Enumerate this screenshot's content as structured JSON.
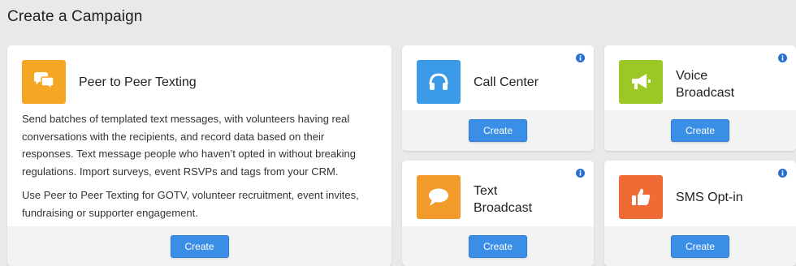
{
  "page": {
    "title": "Create a Campaign"
  },
  "colors": {
    "peer_to_peer": "#f5a623",
    "call_center": "#3b9be8",
    "voice_broadcast": "#9bc824",
    "text_broadcast": "#f29b2a",
    "sms_optin": "#f06a36",
    "button": "#3a8ee6",
    "info": "#2a6fd0"
  },
  "campaigns": {
    "peer_to_peer": {
      "title": "Peer to Peer Texting",
      "icon": "chat-bubbles-icon",
      "description_1": "Send batches of templated text messages, with volunteers having real conversations with the recipients, and record data based on their responses. Text message people who haven’t opted in without breaking regulations. Import surveys, event RSVPs and tags from your CRM.",
      "description_2": "Use Peer to Peer Texting for GOTV, volunteer recruitment, event invites, fundraising or supporter engagement.",
      "button": "Create"
    },
    "call_center": {
      "title": "Call Center",
      "icon": "headset-icon",
      "button": "Create"
    },
    "voice_broadcast": {
      "title_line1": "Voice",
      "title_line2": "Broadcast",
      "icon": "megaphone-icon",
      "button": "Create"
    },
    "text_broadcast": {
      "title_line1": "Text",
      "title_line2": "Broadcast",
      "icon": "speech-bubble-icon",
      "button": "Create"
    },
    "sms_optin": {
      "title": "SMS Opt-in",
      "icon": "thumbs-up-icon",
      "button": "Create"
    }
  }
}
